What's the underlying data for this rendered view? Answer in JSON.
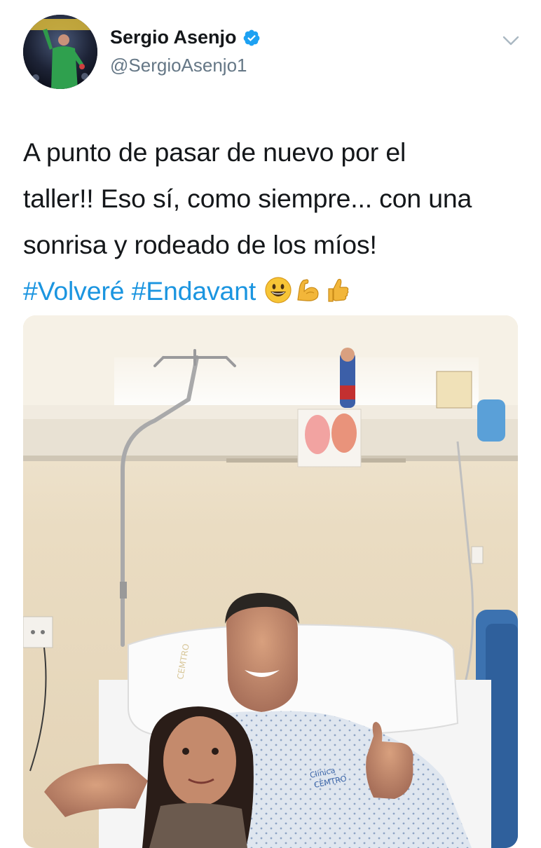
{
  "user": {
    "display_name": "Sergio Asenjo",
    "handle": "@SergioAsenjo1",
    "verified": true
  },
  "tweet": {
    "lines": [
      "A punto de pasar de nuevo por el",
      "taller!! Eso sí, como siempre... con una",
      "sonrisa y rodeado de los míos!"
    ],
    "hashtags": [
      "#Volveré",
      "#Endavant"
    ],
    "emojis": [
      "grinning-face",
      "flexed-biceps",
      "thumbs-up"
    ]
  },
  "photo": {
    "badge_text": "Clínica CEMTRO",
    "pillow_text": "Clínica CEMTRO"
  },
  "colors": {
    "link": "#1b95e0",
    "verified": "#1da1f2",
    "secondary_text": "#657786"
  }
}
